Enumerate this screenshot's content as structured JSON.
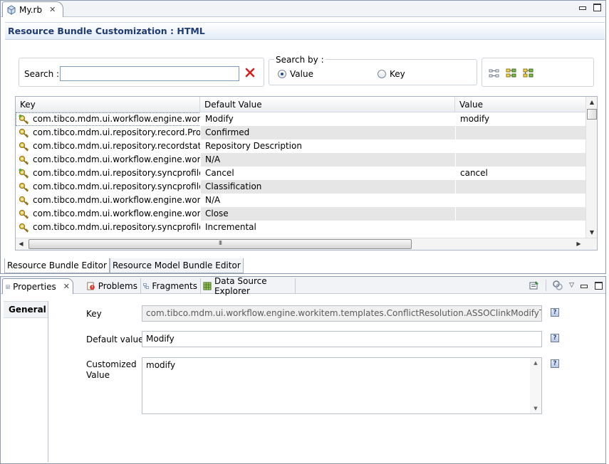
{
  "editor": {
    "tab_title": "My.rb",
    "form_title": "Resource Bundle Customization : HTML",
    "search": {
      "label": "Search :",
      "value": ""
    },
    "search_by": {
      "legend": "Search by :",
      "options": [
        {
          "label": "Value",
          "selected": true
        },
        {
          "label": "Key",
          "selected": false
        }
      ]
    },
    "table": {
      "columns": [
        "Key",
        "Default Value",
        "Value"
      ],
      "rows": [
        {
          "key": "com.tibco.mdm.ui.workflow.engine.worki...",
          "default": "Modify",
          "value": "modify",
          "customized": true
        },
        {
          "key": "com.tibco.mdm.ui.repository.record.Prod...",
          "default": "Confirmed",
          "value": "",
          "customized": false
        },
        {
          "key": "com.tibco.mdm.ui.repository.recordstatus...",
          "default": "Repository Description",
          "value": "",
          "customized": false
        },
        {
          "key": "com.tibco.mdm.ui.workflow.engine.worki...",
          "default": "N/A",
          "value": "",
          "customized": false
        },
        {
          "key": "com.tibco.mdm.ui.repository.syncprofile....",
          "default": "Cancel",
          "value": "cancel",
          "customized": true
        },
        {
          "key": "com.tibco.mdm.ui.repository.syncprofile....",
          "default": "Classification",
          "value": "",
          "customized": false
        },
        {
          "key": "com.tibco.mdm.ui.workflow.engine.worki...",
          "default": "N/A",
          "value": "",
          "customized": false
        },
        {
          "key": "com.tibco.mdm.ui.workflow.engine.worki...",
          "default": "Close",
          "value": "",
          "customized": false
        },
        {
          "key": "com.tibco.mdm.ui.repository.syncprofile....",
          "default": "Incremental",
          "value": "",
          "customized": false
        }
      ]
    },
    "bottom_tabs": [
      "Resource Bundle Editor",
      "Resource Model Bundle Editor"
    ]
  },
  "views": {
    "tabs": [
      "Properties",
      "Problems",
      "Fragments",
      "Data Source Explorer"
    ],
    "section": "General",
    "key_label": "Key",
    "key_value": "com.tibco.mdm.ui.workflow.engine.workitem.templates.ConflictResolution.ASSOClinkModifyText",
    "default_label": "Default value",
    "default_value": "Modify",
    "custom_label_1": "Customized",
    "custom_label_2": "Value",
    "custom_value": "modify"
  },
  "colors": {
    "title_text": "#1f3b73",
    "header_gradient_end": "#e3ecf7",
    "alt_row": "#e6e6e6",
    "clear_icon": "#d42020"
  },
  "icons": [
    "file-icon",
    "close-icon",
    "clear-search-icon",
    "flat-layout-icon",
    "tree-layout-icon",
    "grouped-layout-icon",
    "key-icon",
    "customized-key-icon",
    "properties-icon",
    "problems-icon",
    "fragments-icon",
    "data-source-explorer-icon",
    "pin-icon",
    "filter-icon",
    "view-menu-icon",
    "help-icon"
  ]
}
